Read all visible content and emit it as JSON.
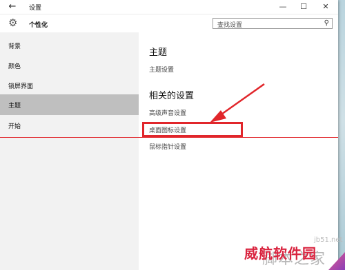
{
  "window": {
    "title": "设置",
    "controls": {
      "minimize": "—",
      "maximize": "☐",
      "close": "✕"
    }
  },
  "header": {
    "section_title": "个性化",
    "search_placeholder": "查找设置"
  },
  "sidebar": {
    "items": [
      {
        "label": "背景"
      },
      {
        "label": "颜色"
      },
      {
        "label": "锁屏界面"
      },
      {
        "label": "主题",
        "active": true
      },
      {
        "label": "开始"
      }
    ]
  },
  "content": {
    "theme_heading": "主题",
    "theme_settings_link": "主题设置",
    "related_heading": "相关的设置",
    "links": [
      {
        "label": "高级声音设置"
      },
      {
        "label": "桌面图标设置",
        "highlighted": true
      },
      {
        "label": "鼠标指针设置"
      }
    ]
  },
  "annotation_color": "#e1262b",
  "watermark": {
    "domain": "jb51.net",
    "name": "脚本之家",
    "brand": "威航软件园"
  }
}
